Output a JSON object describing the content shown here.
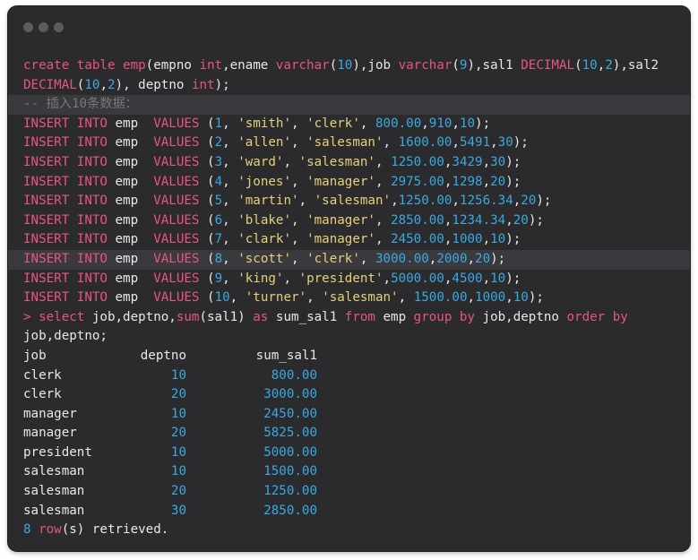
{
  "window": {
    "traffic_lights": [
      "close",
      "minimize",
      "zoom"
    ]
  },
  "code": {
    "create": {
      "kw_create": "create table",
      "table": "emp",
      "part1": "(empno ",
      "t_int1": "int",
      "part2": ",ename ",
      "t_varchar1": "varchar",
      "p3": "(",
      "n10a": "10",
      "p4": "),job ",
      "t_varchar2": "varchar",
      "p5": "(",
      "n9": "9",
      "p6": "),sal1 ",
      "t_dec1": "DECIMAL",
      "p7": "(",
      "n10b": "10",
      "p8": ",",
      "n2a": "2",
      "p9": "),sal2",
      "t_dec2": "DECIMAL",
      "p10": "(",
      "n10c": "10",
      "p11": ",",
      "n2b": "2",
      "p12": "), deptno ",
      "t_int2": "int",
      "p13": ");"
    },
    "comment": "-- 插入10条数据：",
    "inserts": [
      {
        "kw": "INSERT INTO",
        "tbl": " emp  ",
        "values_kw": "VALUES",
        "open": " (",
        "id": "1",
        "s1": ", ",
        "name": "'smith'",
        "s2": ", ",
        "job": "'clerk'",
        "s3": ", ",
        "sal1": "800.00",
        "s4": ",",
        "sal2": "910",
        "s5": ",",
        "dept": "10",
        "close": ");"
      },
      {
        "kw": "INSERT INTO",
        "tbl": " emp  ",
        "values_kw": "VALUES",
        "open": " (",
        "id": "2",
        "s1": ", ",
        "name": "'allen'",
        "s2": ", ",
        "job": "'salesman'",
        "s3": ", ",
        "sal1": "1600.00",
        "s4": ",",
        "sal2": "5491",
        "s5": ",",
        "dept": "30",
        "close": ");"
      },
      {
        "kw": "INSERT INTO",
        "tbl": " emp  ",
        "values_kw": "VALUES",
        "open": " (",
        "id": "3",
        "s1": ", ",
        "name": "'ward'",
        "s2": ", ",
        "job": "'salesman'",
        "s3": ", ",
        "sal1": "1250.00",
        "s4": ",",
        "sal2": "3429",
        "s5": ",",
        "dept": "30",
        "close": ");"
      },
      {
        "kw": "INSERT INTO",
        "tbl": " emp  ",
        "values_kw": "VALUES",
        "open": " (",
        "id": "4",
        "s1": ", ",
        "name": "'jones'",
        "s2": ", ",
        "job": "'manager'",
        "s3": ", ",
        "sal1": "2975.00",
        "s4": ",",
        "sal2": "1298",
        "s5": ",",
        "dept": "20",
        "close": ");"
      },
      {
        "kw": "INSERT INTO",
        "tbl": " emp  ",
        "values_kw": "VALUES",
        "open": " (",
        "id": "5",
        "s1": ", ",
        "name": "'martin'",
        "s2": ", ",
        "job": "'salesman'",
        "s3": ",",
        "sal1": "1250.00",
        "s4": ",",
        "sal2": "1256.34",
        "s5": ",",
        "dept": "20",
        "close": ");"
      },
      {
        "kw": "INSERT INTO",
        "tbl": " emp  ",
        "values_kw": "VALUES",
        "open": " (",
        "id": "6",
        "s1": ", ",
        "name": "'blake'",
        "s2": ", ",
        "job": "'manager'",
        "s3": ", ",
        "sal1": "2850.00",
        "s4": ",",
        "sal2": "1234.34",
        "s5": ",",
        "dept": "20",
        "close": ");"
      },
      {
        "kw": "INSERT INTO",
        "tbl": " emp  ",
        "values_kw": "VALUES",
        "open": " (",
        "id": "7",
        "s1": ", ",
        "name": "'clark'",
        "s2": ", ",
        "job": "'manager'",
        "s3": ", ",
        "sal1": "2450.00",
        "s4": ",",
        "sal2": "1000",
        "s5": ",",
        "dept": "10",
        "close": ");"
      },
      {
        "kw": "INSERT INTO",
        "tbl": " emp  ",
        "values_kw": "VALUES",
        "open": " (",
        "id": "8",
        "s1": ", ",
        "name": "'scott'",
        "s2": ", ",
        "job": "'clerk'",
        "s3": ", ",
        "sal1": "3000.00",
        "s4": ",",
        "sal2": "2000",
        "s5": ",",
        "dept": "20",
        "close": ");"
      },
      {
        "kw": "INSERT INTO",
        "tbl": " emp  ",
        "values_kw": "VALUES",
        "open": " (",
        "id": "9",
        "s1": ", ",
        "name": "'king'",
        "s2": ", ",
        "job": "'president'",
        "s3": ",",
        "sal1": "5000.00",
        "s4": ",",
        "sal2": "4500",
        "s5": ",",
        "dept": "10",
        "close": ");"
      },
      {
        "kw": "INSERT INTO",
        "tbl": " emp  ",
        "values_kw": "VALUES",
        "open": " (",
        "id": "10",
        "s1": ", ",
        "name": "'turner'",
        "s2": ", ",
        "job": "'salesman'",
        "s3": ", ",
        "sal1": "1500.00",
        "s4": ",",
        "sal2": "1000",
        "s5": ",",
        "dept": "10",
        "close": ");"
      }
    ],
    "select": {
      "prompt": ">",
      "kw_select": "select",
      "cols": " job,deptno,",
      "fn_sum": "sum",
      "arg": "(sal1) ",
      "kw_as": "as",
      "alias": " sum_sal1 ",
      "kw_from": "from",
      "from_tbl": " emp ",
      "kw_group": "group by",
      "group_cols": " job,deptno ",
      "kw_order": "order by",
      "order_cont": "job,deptno;"
    },
    "result": {
      "headers": [
        "job",
        "deptno",
        "sum_sal1"
      ],
      "rows": [
        {
          "job": "clerk",
          "deptno": "10",
          "sum_sal1": "800.00"
        },
        {
          "job": "clerk",
          "deptno": "20",
          "sum_sal1": "3000.00"
        },
        {
          "job": "manager",
          "deptno": "10",
          "sum_sal1": "2450.00"
        },
        {
          "job": "manager",
          "deptno": "20",
          "sum_sal1": "5825.00"
        },
        {
          "job": "president",
          "deptno": "10",
          "sum_sal1": "5000.00"
        },
        {
          "job": "salesman",
          "deptno": "10",
          "sum_sal1": "1500.00"
        },
        {
          "job": "salesman",
          "deptno": "20",
          "sum_sal1": "1250.00"
        },
        {
          "job": "salesman",
          "deptno": "30",
          "sum_sal1": "2850.00"
        }
      ],
      "footer_count": "8",
      "footer_row": " row",
      "footer_rest": "(s) retrieved."
    }
  },
  "colors": {
    "background": "#2b2b2d",
    "keyword": "#e8557e",
    "number": "#3aa9e0",
    "string": "#e5d07a",
    "comment": "#77777c",
    "text": "#e8e8ea"
  }
}
